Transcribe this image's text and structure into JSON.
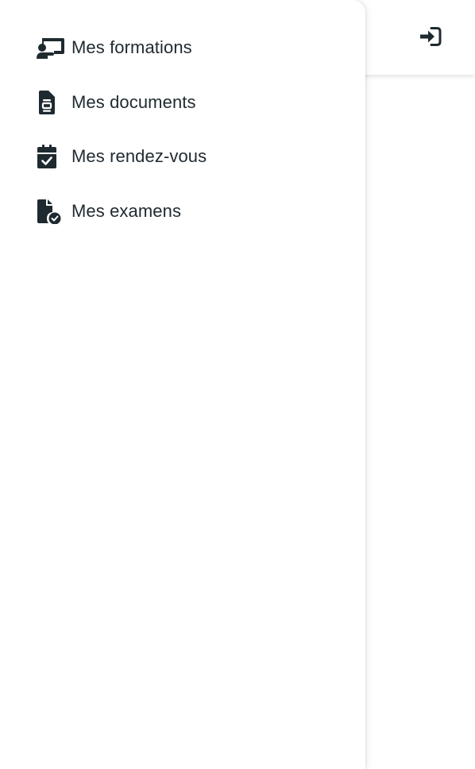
{
  "header": {
    "login_icon": "sign-in-icon"
  },
  "drawer": {
    "items": [
      {
        "label": "Mes formations",
        "icon": "chalkboard-teacher-icon"
      },
      {
        "label": "Mes documents",
        "icon": "document-icon"
      },
      {
        "label": "Mes rendez-vous",
        "icon": "calendar-check-icon"
      },
      {
        "label": "Mes examens",
        "icon": "file-check-icon"
      }
    ]
  },
  "colors": {
    "text": "#1f2a30",
    "icon": "#1f2a30",
    "background": "#ffffff"
  }
}
